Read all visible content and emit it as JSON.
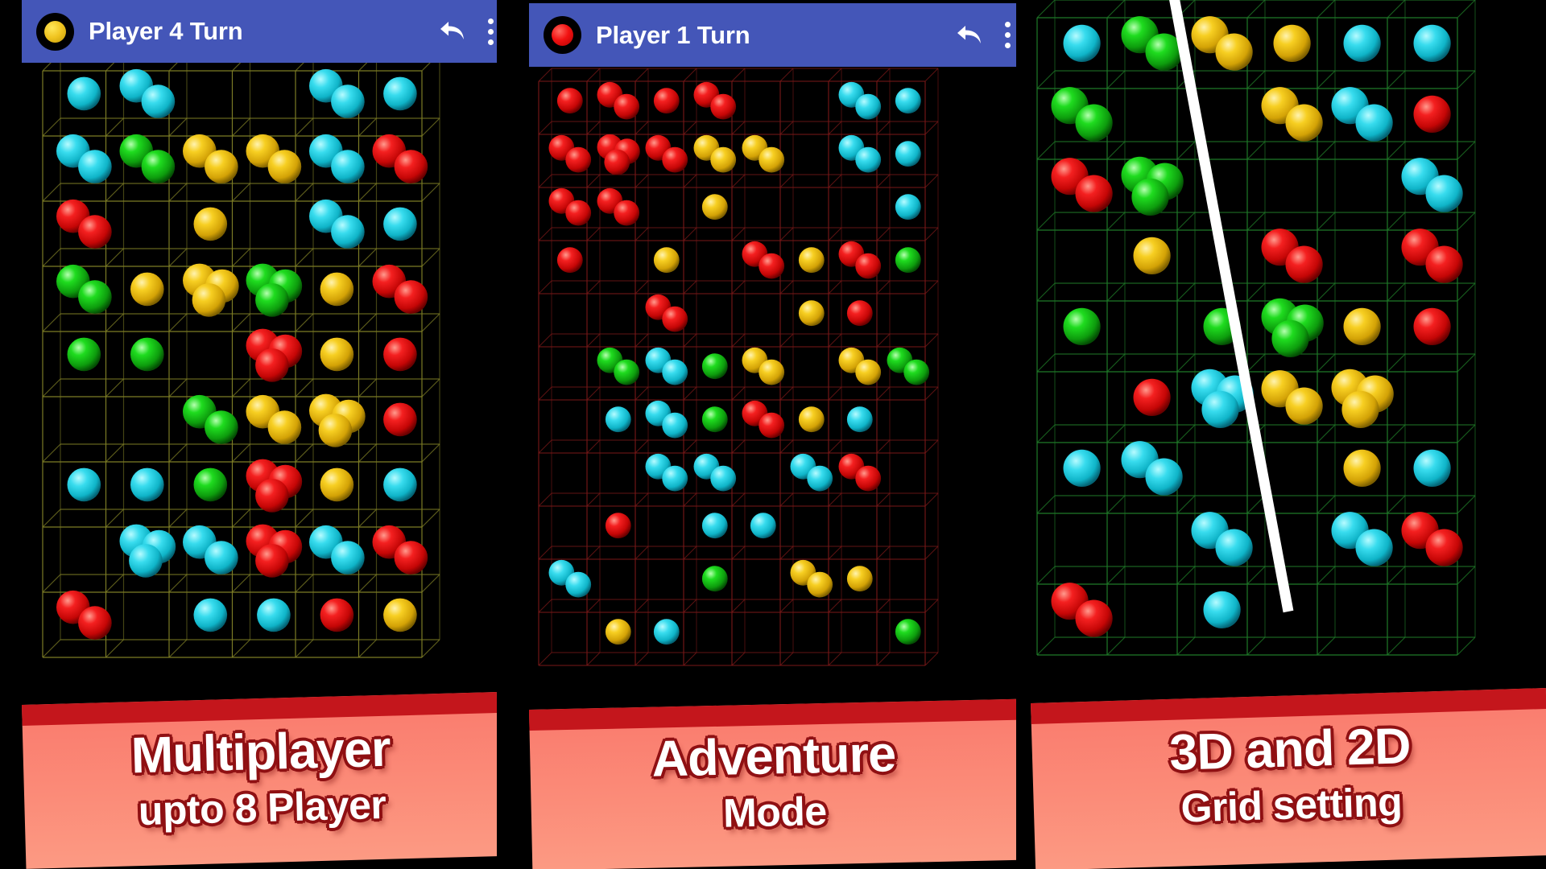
{
  "app": {
    "name": "Chain Reaction Game Promo",
    "background_color": "#000000",
    "appbar_color": "#4456b8",
    "banner_color": "#fa7a6d",
    "banner_stripe_color": "#c4161c",
    "banner_text_color": "#ffffff",
    "banner_text_outline": "#8f1013"
  },
  "panels": [
    {
      "id": "panel-1",
      "appbar": {
        "turn_indicator_color": "#f0c420",
        "turn_indicator_name": "yellow-player-token",
        "title": "Player 4 Turn",
        "undo_label": "undo-icon",
        "menu_label": "overflow-menu-icon"
      },
      "board": {
        "grid_color": "#8a8a2a",
        "cols": 6,
        "rows": 9,
        "orbs": [
          {
            "c": 0,
            "r": 0,
            "n": 1,
            "color": "cyan"
          },
          {
            "c": 1,
            "r": 0,
            "n": 2,
            "color": "cyan"
          },
          {
            "c": 4,
            "r": 0,
            "n": 2,
            "color": "cyan"
          },
          {
            "c": 5,
            "r": 0,
            "n": 1,
            "color": "cyan"
          },
          {
            "c": 0,
            "r": 1,
            "n": 2,
            "color": "cyan"
          },
          {
            "c": 1,
            "r": 1,
            "n": 2,
            "color": "green"
          },
          {
            "c": 2,
            "r": 1,
            "n": 2,
            "color": "yellow"
          },
          {
            "c": 3,
            "r": 1,
            "n": 2,
            "color": "yellow"
          },
          {
            "c": 4,
            "r": 1,
            "n": 2,
            "color": "cyan"
          },
          {
            "c": 5,
            "r": 1,
            "n": 2,
            "color": "red"
          },
          {
            "c": 0,
            "r": 2,
            "n": 2,
            "color": "red"
          },
          {
            "c": 2,
            "r": 2,
            "n": 1,
            "color": "yellow"
          },
          {
            "c": 4,
            "r": 2,
            "n": 2,
            "color": "cyan"
          },
          {
            "c": 5,
            "r": 2,
            "n": 1,
            "color": "cyan"
          },
          {
            "c": 0,
            "r": 3,
            "n": 2,
            "color": "green"
          },
          {
            "c": 1,
            "r": 3,
            "n": 1,
            "color": "yellow"
          },
          {
            "c": 2,
            "r": 3,
            "n": 3,
            "color": "yellow"
          },
          {
            "c": 3,
            "r": 3,
            "n": 3,
            "color": "green"
          },
          {
            "c": 4,
            "r": 3,
            "n": 1,
            "color": "yellow"
          },
          {
            "c": 5,
            "r": 3,
            "n": 2,
            "color": "red"
          },
          {
            "c": 0,
            "r": 4,
            "n": 1,
            "color": "green"
          },
          {
            "c": 1,
            "r": 4,
            "n": 1,
            "color": "green"
          },
          {
            "c": 3,
            "r": 4,
            "n": 3,
            "color": "red"
          },
          {
            "c": 4,
            "r": 4,
            "n": 1,
            "color": "yellow"
          },
          {
            "c": 5,
            "r": 4,
            "n": 1,
            "color": "red"
          },
          {
            "c": 2,
            "r": 5,
            "n": 2,
            "color": "green"
          },
          {
            "c": 3,
            "r": 5,
            "n": 2,
            "color": "yellow"
          },
          {
            "c": 4,
            "r": 5,
            "n": 3,
            "color": "yellow"
          },
          {
            "c": 5,
            "r": 5,
            "n": 1,
            "color": "red"
          },
          {
            "c": 0,
            "r": 6,
            "n": 1,
            "color": "cyan"
          },
          {
            "c": 1,
            "r": 6,
            "n": 1,
            "color": "cyan"
          },
          {
            "c": 2,
            "r": 6,
            "n": 1,
            "color": "green"
          },
          {
            "c": 3,
            "r": 6,
            "n": 3,
            "color": "red"
          },
          {
            "c": 4,
            "r": 6,
            "n": 1,
            "color": "yellow"
          },
          {
            "c": 5,
            "r": 6,
            "n": 1,
            "color": "cyan"
          },
          {
            "c": 1,
            "r": 7,
            "n": 3,
            "color": "cyan"
          },
          {
            "c": 2,
            "r": 7,
            "n": 2,
            "color": "cyan"
          },
          {
            "c": 3,
            "r": 7,
            "n": 3,
            "color": "red"
          },
          {
            "c": 4,
            "r": 7,
            "n": 2,
            "color": "cyan"
          },
          {
            "c": 5,
            "r": 7,
            "n": 2,
            "color": "red"
          },
          {
            "c": 0,
            "r": 8,
            "n": 2,
            "color": "red"
          },
          {
            "c": 2,
            "r": 8,
            "n": 1,
            "color": "cyan"
          },
          {
            "c": 3,
            "r": 8,
            "n": 1,
            "color": "cyan"
          },
          {
            "c": 4,
            "r": 8,
            "n": 1,
            "color": "red"
          },
          {
            "c": 5,
            "r": 8,
            "n": 1,
            "color": "yellow"
          }
        ]
      },
      "banner": {
        "line1": "Multiplayer",
        "line2": "upto 8 Player"
      }
    },
    {
      "id": "panel-2",
      "appbar": {
        "turn_indicator_color": "#f21212",
        "turn_indicator_name": "red-player-token",
        "title": "Player 1 Turn",
        "undo_label": "undo-icon",
        "menu_label": "overflow-menu-icon"
      },
      "board": {
        "grid_color": "#7a1818",
        "cols": 8,
        "rows": 11,
        "orbs": [
          {
            "c": 0,
            "r": 0,
            "n": 1,
            "color": "red"
          },
          {
            "c": 1,
            "r": 0,
            "n": 2,
            "color": "red"
          },
          {
            "c": 2,
            "r": 0,
            "n": 1,
            "color": "red"
          },
          {
            "c": 3,
            "r": 0,
            "n": 2,
            "color": "red"
          },
          {
            "c": 6,
            "r": 0,
            "n": 2,
            "color": "cyan"
          },
          {
            "c": 7,
            "r": 0,
            "n": 1,
            "color": "cyan"
          },
          {
            "c": 0,
            "r": 1,
            "n": 2,
            "color": "red"
          },
          {
            "c": 1,
            "r": 1,
            "n": 3,
            "color": "red"
          },
          {
            "c": 2,
            "r": 1,
            "n": 2,
            "color": "red"
          },
          {
            "c": 3,
            "r": 1,
            "n": 2,
            "color": "yellow"
          },
          {
            "c": 4,
            "r": 1,
            "n": 2,
            "color": "yellow"
          },
          {
            "c": 6,
            "r": 1,
            "n": 2,
            "color": "cyan"
          },
          {
            "c": 7,
            "r": 1,
            "n": 1,
            "color": "cyan"
          },
          {
            "c": 0,
            "r": 2,
            "n": 2,
            "color": "red"
          },
          {
            "c": 1,
            "r": 2,
            "n": 2,
            "color": "red"
          },
          {
            "c": 3,
            "r": 2,
            "n": 1,
            "color": "yellow"
          },
          {
            "c": 7,
            "r": 2,
            "n": 1,
            "color": "cyan"
          },
          {
            "c": 0,
            "r": 3,
            "n": 1,
            "color": "red"
          },
          {
            "c": 2,
            "r": 3,
            "n": 1,
            "color": "yellow"
          },
          {
            "c": 4,
            "r": 3,
            "n": 2,
            "color": "red"
          },
          {
            "c": 5,
            "r": 3,
            "n": 1,
            "color": "yellow"
          },
          {
            "c": 6,
            "r": 3,
            "n": 2,
            "color": "red"
          },
          {
            "c": 7,
            "r": 3,
            "n": 1,
            "color": "green"
          },
          {
            "c": 2,
            "r": 4,
            "n": 2,
            "color": "red"
          },
          {
            "c": 5,
            "r": 4,
            "n": 1,
            "color": "yellow"
          },
          {
            "c": 6,
            "r": 4,
            "n": 1,
            "color": "red"
          },
          {
            "c": 1,
            "r": 5,
            "n": 2,
            "color": "green"
          },
          {
            "c": 2,
            "r": 5,
            "n": 2,
            "color": "cyan"
          },
          {
            "c": 3,
            "r": 5,
            "n": 1,
            "color": "green"
          },
          {
            "c": 4,
            "r": 5,
            "n": 2,
            "color": "yellow"
          },
          {
            "c": 6,
            "r": 5,
            "n": 2,
            "color": "yellow"
          },
          {
            "c": 7,
            "r": 5,
            "n": 2,
            "color": "green"
          },
          {
            "c": 1,
            "r": 6,
            "n": 1,
            "color": "cyan"
          },
          {
            "c": 2,
            "r": 6,
            "n": 2,
            "color": "cyan"
          },
          {
            "c": 3,
            "r": 6,
            "n": 1,
            "color": "green"
          },
          {
            "c": 4,
            "r": 6,
            "n": 2,
            "color": "red"
          },
          {
            "c": 5,
            "r": 6,
            "n": 1,
            "color": "yellow"
          },
          {
            "c": 6,
            "r": 6,
            "n": 1,
            "color": "cyan"
          },
          {
            "c": 2,
            "r": 7,
            "n": 2,
            "color": "cyan"
          },
          {
            "c": 3,
            "r": 7,
            "n": 2,
            "color": "cyan"
          },
          {
            "c": 5,
            "r": 7,
            "n": 2,
            "color": "cyan"
          },
          {
            "c": 6,
            "r": 7,
            "n": 2,
            "color": "red"
          },
          {
            "c": 1,
            "r": 8,
            "n": 1,
            "color": "red"
          },
          {
            "c": 3,
            "r": 8,
            "n": 1,
            "color": "cyan"
          },
          {
            "c": 4,
            "r": 8,
            "n": 1,
            "color": "cyan"
          },
          {
            "c": 0,
            "r": 9,
            "n": 2,
            "color": "cyan"
          },
          {
            "c": 3,
            "r": 9,
            "n": 1,
            "color": "green"
          },
          {
            "c": 5,
            "r": 9,
            "n": 2,
            "color": "yellow"
          },
          {
            "c": 6,
            "r": 9,
            "n": 1,
            "color": "yellow"
          },
          {
            "c": 1,
            "r": 10,
            "n": 1,
            "color": "yellow"
          },
          {
            "c": 2,
            "r": 10,
            "n": 1,
            "color": "cyan"
          },
          {
            "c": 7,
            "r": 10,
            "n": 1,
            "color": "green"
          }
        ]
      },
      "banner": {
        "line1": "Adventure",
        "line2": "Mode"
      }
    },
    {
      "id": "panel-3",
      "appbar": {
        "turn_indicator_color": null,
        "turn_indicator_name": "none",
        "title": "",
        "undo_label": "undo-icon",
        "menu_label": "overflow-menu-icon"
      },
      "board": {
        "grid_color": "#1f7a28",
        "cols": 6,
        "rows": 9,
        "has_white_divider": true,
        "white_divider_color": "#ffffff",
        "orbs": [
          {
            "c": 0,
            "r": 0,
            "n": 1,
            "color": "cyan"
          },
          {
            "c": 1,
            "r": 0,
            "n": 2,
            "color": "green"
          },
          {
            "c": 2,
            "r": 0,
            "n": 2,
            "color": "yellow"
          },
          {
            "c": 3,
            "r": 0,
            "n": 1,
            "color": "yellow"
          },
          {
            "c": 4,
            "r": 0,
            "n": 1,
            "color": "cyan"
          },
          {
            "c": 5,
            "r": 0,
            "n": 1,
            "color": "cyan"
          },
          {
            "c": 0,
            "r": 1,
            "n": 2,
            "color": "green"
          },
          {
            "c": 3,
            "r": 1,
            "n": 2,
            "color": "yellow"
          },
          {
            "c": 4,
            "r": 1,
            "n": 2,
            "color": "cyan"
          },
          {
            "c": 5,
            "r": 1,
            "n": 1,
            "color": "red"
          },
          {
            "c": 0,
            "r": 2,
            "n": 2,
            "color": "red"
          },
          {
            "c": 1,
            "r": 2,
            "n": 3,
            "color": "green"
          },
          {
            "c": 5,
            "r": 2,
            "n": 2,
            "color": "cyan"
          },
          {
            "c": 1,
            "r": 3,
            "n": 1,
            "color": "yellow"
          },
          {
            "c": 3,
            "r": 3,
            "n": 2,
            "color": "red"
          },
          {
            "c": 5,
            "r": 3,
            "n": 2,
            "color": "red"
          },
          {
            "c": 0,
            "r": 4,
            "n": 1,
            "color": "green"
          },
          {
            "c": 2,
            "r": 4,
            "n": 1,
            "color": "green"
          },
          {
            "c": 3,
            "r": 4,
            "n": 3,
            "color": "green"
          },
          {
            "c": 4,
            "r": 4,
            "n": 1,
            "color": "yellow"
          },
          {
            "c": 5,
            "r": 4,
            "n": 1,
            "color": "red"
          },
          {
            "c": 1,
            "r": 5,
            "n": 1,
            "color": "red"
          },
          {
            "c": 2,
            "r": 5,
            "n": 3,
            "color": "cyan"
          },
          {
            "c": 3,
            "r": 5,
            "n": 2,
            "color": "yellow"
          },
          {
            "c": 4,
            "r": 5,
            "n": 3,
            "color": "yellow"
          },
          {
            "c": 0,
            "r": 6,
            "n": 1,
            "color": "cyan"
          },
          {
            "c": 1,
            "r": 6,
            "n": 2,
            "color": "cyan"
          },
          {
            "c": 4,
            "r": 6,
            "n": 1,
            "color": "yellow"
          },
          {
            "c": 5,
            "r": 6,
            "n": 1,
            "color": "cyan"
          },
          {
            "c": 2,
            "r": 7,
            "n": 2,
            "color": "cyan"
          },
          {
            "c": 4,
            "r": 7,
            "n": 2,
            "color": "cyan"
          },
          {
            "c": 5,
            "r": 7,
            "n": 2,
            "color": "red"
          },
          {
            "c": 0,
            "r": 8,
            "n": 2,
            "color": "red"
          },
          {
            "c": 2,
            "r": 8,
            "n": 1,
            "color": "cyan"
          }
        ]
      },
      "banner": {
        "line1": "3D and 2D",
        "line2": "Grid setting"
      }
    }
  ],
  "orb_colors": {
    "cyan": "#22d3e8",
    "red": "#ee1111",
    "green": "#11c511",
    "yellow": "#f2c10c"
  }
}
